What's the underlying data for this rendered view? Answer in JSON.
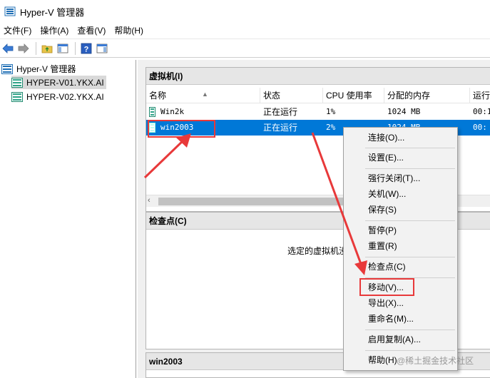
{
  "window": {
    "title": "Hyper-V 管理器"
  },
  "menubar": {
    "items": [
      "文件(F)",
      "操作(A)",
      "查看(V)",
      "帮助(H)"
    ]
  },
  "toolbar": {
    "buttons": [
      "back-icon",
      "forward-icon",
      "folder-up-icon",
      "show-hide-tree-icon",
      "help-icon",
      "action-pane-icon"
    ]
  },
  "tree": {
    "root": "Hyper-V 管理器",
    "servers": [
      "HYPER-V01.YKX.AI",
      "HYPER-V02.YKX.AI"
    ],
    "selected_server": "HYPER-V01.YKX.AI"
  },
  "vm_panel": {
    "title": "虚拟机(I)",
    "columns": [
      "名称",
      "状态",
      "CPU 使用率",
      "分配的内存",
      "运行"
    ],
    "rows": [
      {
        "name": "Win2k",
        "state": "正在运行",
        "cpu": "1%",
        "memory": "1024 MB",
        "uptime": "00:1"
      },
      {
        "name": "win2003",
        "state": "正在运行",
        "cpu": "2%",
        "memory": "1024 MB",
        "uptime": "00:"
      }
    ],
    "selected_row": "win2003"
  },
  "checkpoint_panel": {
    "title": "检查点(C)",
    "message": "选定的虚拟机没"
  },
  "details_panel": {
    "title": "win2003"
  },
  "context_menu": {
    "items": [
      {
        "label": "连接(O)..."
      },
      {
        "label": "设置(E)..."
      },
      {
        "label": "强行关闭(T)..."
      },
      {
        "label": "关机(W)..."
      },
      {
        "label": "保存(S)"
      },
      {
        "label": "暂停(P)"
      },
      {
        "label": "重置(R)"
      },
      {
        "label": "检查点(C)"
      },
      {
        "label": "移动(V)..."
      },
      {
        "label": "导出(X)..."
      },
      {
        "label": "重命名(M)..."
      },
      {
        "label": "启用复制(A)..."
      },
      {
        "label": "帮助(H)"
      }
    ],
    "highlighted": "移动(V)..."
  },
  "annotations": {
    "highlight_color": "#e8393a"
  },
  "watermark": {
    "text": "@稀土掘金技术社区"
  },
  "colors": {
    "selection": "#0078d7",
    "panel_header": "#e6e6e6"
  }
}
